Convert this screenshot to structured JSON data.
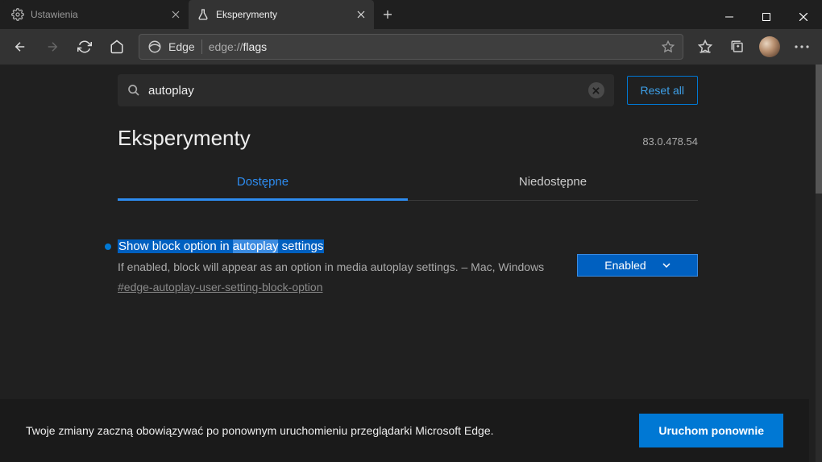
{
  "browser": {
    "tabs": [
      {
        "title": "Ustawienia",
        "active": false
      },
      {
        "title": "Eksperymenty",
        "active": true
      }
    ],
    "address": {
      "identity": "Edge",
      "protocol": "edge://",
      "path": "flags"
    }
  },
  "page": {
    "search": {
      "value": "autoplay"
    },
    "reset_label": "Reset all",
    "title": "Eksperymenty",
    "version": "83.0.478.54",
    "tabs": {
      "available": "Dostępne",
      "unavailable": "Niedostępne"
    },
    "flag": {
      "title_pre": "Show block option in ",
      "title_hl": "autoplay",
      "title_post": " settings",
      "desc": "If enabled, block will appear as an option in media autoplay settings. – Mac, Windows",
      "hash": "#edge-autoplay-user-setting-block-option",
      "select_value": "Enabled"
    }
  },
  "footer": {
    "message": "Twoje zmiany zaczną obowiązywać po ponownym uruchomieniu przeglądarki Microsoft Edge.",
    "restart": "Uruchom ponownie"
  }
}
